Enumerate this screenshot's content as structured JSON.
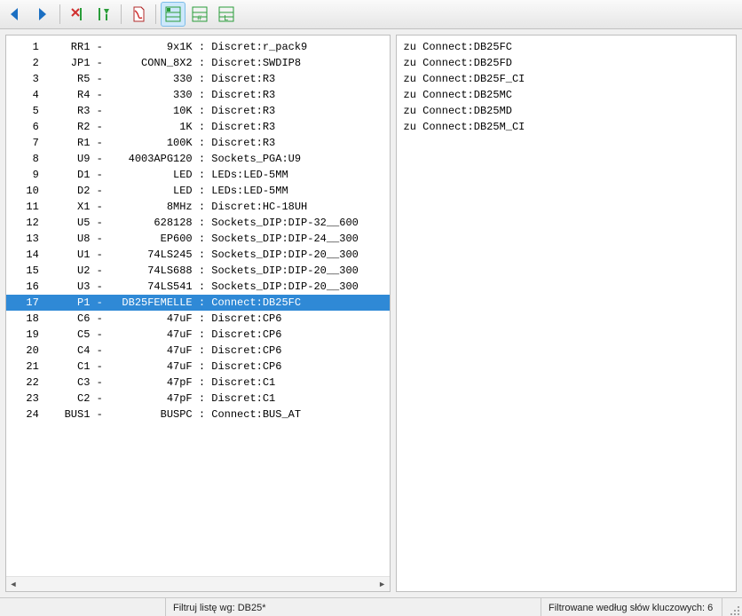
{
  "toolbar": {
    "buttons": [
      {
        "name": "back-button",
        "icon": "arrow-left"
      },
      {
        "name": "forward-button",
        "icon": "arrow-right"
      },
      {
        "name": "sep"
      },
      {
        "name": "undo-assoc-button",
        "icon": "x-red-green"
      },
      {
        "name": "auto-annotate-button",
        "icon": "green-down"
      },
      {
        "name": "sep"
      },
      {
        "name": "export-pdf-button",
        "icon": "pdf"
      },
      {
        "name": "sep"
      },
      {
        "name": "view-grouped-button",
        "icon": "grid-green",
        "active": true
      },
      {
        "name": "view-by-ref-button",
        "icon": "grid-hash"
      },
      {
        "name": "view-by-value-button",
        "icon": "grid-l"
      }
    ]
  },
  "component_list": {
    "selected_index": 16,
    "rows": [
      {
        "n": "1",
        "ref": "RR1",
        "val": "9x1K",
        "foot": "Discret:r_pack9"
      },
      {
        "n": "2",
        "ref": "JP1",
        "val": "CONN_8X2",
        "foot": "Discret:SWDIP8"
      },
      {
        "n": "3",
        "ref": "R5",
        "val": "330",
        "foot": "Discret:R3"
      },
      {
        "n": "4",
        "ref": "R4",
        "val": "330",
        "foot": "Discret:R3"
      },
      {
        "n": "5",
        "ref": "R3",
        "val": "10K",
        "foot": "Discret:R3"
      },
      {
        "n": "6",
        "ref": "R2",
        "val": "1K",
        "foot": "Discret:R3"
      },
      {
        "n": "7",
        "ref": "R1",
        "val": "100K",
        "foot": "Discret:R3"
      },
      {
        "n": "8",
        "ref": "U9",
        "val": "4003APG120",
        "foot": "Sockets_PGA:U9"
      },
      {
        "n": "9",
        "ref": "D1",
        "val": "LED",
        "foot": "LEDs:LED-5MM"
      },
      {
        "n": "10",
        "ref": "D2",
        "val": "LED",
        "foot": "LEDs:LED-5MM"
      },
      {
        "n": "11",
        "ref": "X1",
        "val": "8MHz",
        "foot": "Discret:HC-18UH"
      },
      {
        "n": "12",
        "ref": "U5",
        "val": "628128",
        "foot": "Sockets_DIP:DIP-32__600"
      },
      {
        "n": "13",
        "ref": "U8",
        "val": "EP600",
        "foot": "Sockets_DIP:DIP-24__300"
      },
      {
        "n": "14",
        "ref": "U1",
        "val": "74LS245",
        "foot": "Sockets_DIP:DIP-20__300"
      },
      {
        "n": "15",
        "ref": "U2",
        "val": "74LS688",
        "foot": "Sockets_DIP:DIP-20__300"
      },
      {
        "n": "16",
        "ref": "U3",
        "val": "74LS541",
        "foot": "Sockets_DIP:DIP-20__300"
      },
      {
        "n": "17",
        "ref": "P1",
        "val": "DB25FEMELLE",
        "foot": "Connect:DB25FC"
      },
      {
        "n": "18",
        "ref": "C6",
        "val": "47uF",
        "foot": "Discret:CP6"
      },
      {
        "n": "19",
        "ref": "C5",
        "val": "47uF",
        "foot": "Discret:CP6"
      },
      {
        "n": "20",
        "ref": "C4",
        "val": "47uF",
        "foot": "Discret:CP6"
      },
      {
        "n": "21",
        "ref": "C1",
        "val": "47uF",
        "foot": "Discret:CP6"
      },
      {
        "n": "22",
        "ref": "C3",
        "val": "47pF",
        "foot": "Discret:C1"
      },
      {
        "n": "23",
        "ref": "C2",
        "val": "47pF",
        "foot": "Discret:C1"
      },
      {
        "n": "24",
        "ref": "BUS1",
        "val": "BUSPC",
        "foot": "Connect:BUS_AT"
      }
    ]
  },
  "matches": [
    "zu Connect:DB25FC",
    "zu Connect:DB25FD",
    "zu Connect:DB25F_CI",
    "zu Connect:DB25MC",
    "zu Connect:DB25MD",
    "zu Connect:DB25M_CI"
  ],
  "status": {
    "filter_label": "Filtruj listę wg: DB25*",
    "result_label": "Filtrowane według słów kluczowych: 6"
  }
}
